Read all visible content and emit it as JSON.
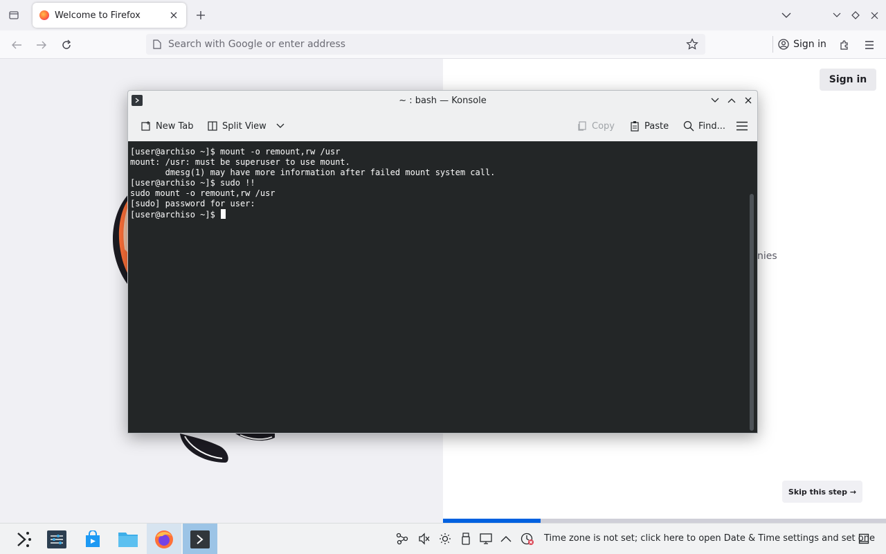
{
  "firefox": {
    "tab_title": "Welcome to Firefox",
    "url_placeholder": "Search with Google or enter address",
    "signin_label": "Sign in"
  },
  "page": {
    "signin_label": "Sign in",
    "partial_text": "nies",
    "skip_label": "Skip this step →",
    "progress": 0.22
  },
  "konsole": {
    "title": "~ : bash — Konsole",
    "toolbar": {
      "new_tab": "New Tab",
      "split_view": "Split View",
      "copy": "Copy",
      "paste": "Paste",
      "find": "Find..."
    },
    "lines": [
      "[user@archiso ~]$ mount -o remount,rw /usr",
      "mount: /usr: must be superuser to use mount.",
      "       dmesg(1) may have more information after failed mount system call.",
      "[user@archiso ~]$ sudo !!",
      "sudo mount -o remount,rw /usr",
      "[sudo] password for user:",
      "[user@archiso ~]$ "
    ]
  },
  "taskbar": {
    "notice": "Time zone is not set; click here to open Date & Time settings and set one"
  },
  "colors": {
    "accent": "#0061e0",
    "terminal_bg": "#232627",
    "terminal_fg": "#fcfcfc"
  }
}
